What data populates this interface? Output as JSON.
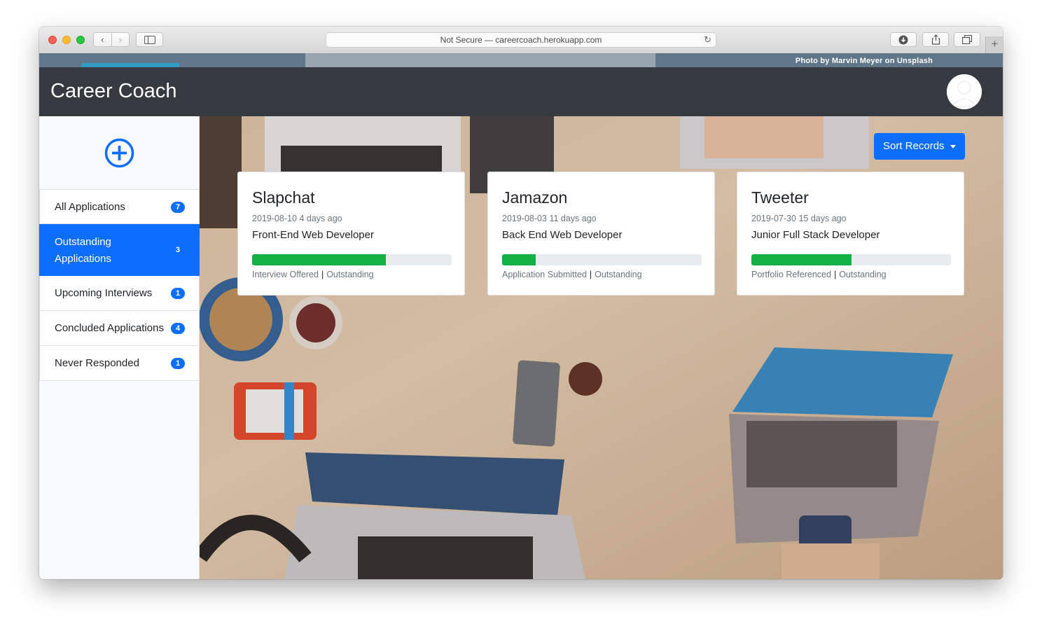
{
  "browser": {
    "url_text": "Not Secure — careercoach.herokuapp.com"
  },
  "page": {
    "photo_credit": "Photo by Marvin Meyer on Unsplash",
    "brand": "Career Coach"
  },
  "sidebar": {
    "items": [
      {
        "label": "All Applications",
        "count": "7",
        "active": false
      },
      {
        "label": "Outstanding Applications",
        "count": "3",
        "active": true
      },
      {
        "label": "Upcoming Interviews",
        "count": "1",
        "active": false
      },
      {
        "label": "Concluded Applications",
        "count": "4",
        "active": false
      },
      {
        "label": "Never Responded",
        "count": "1",
        "active": false
      }
    ]
  },
  "sort_button": {
    "label": "Sort Records"
  },
  "cards": [
    {
      "company": "Slapchat",
      "date": "2019-08-10",
      "ago": "4 days ago",
      "role": "Front-End Web Developer",
      "progress": 0.67,
      "stage": "Interview Offered",
      "state": "Outstanding"
    },
    {
      "company": "Jamazon",
      "date": "2019-08-03",
      "ago": "11 days ago",
      "role": "Back End Web Developer",
      "progress": 0.17,
      "stage": "Application Submitted",
      "state": "Outstanding"
    },
    {
      "company": "Tweeter",
      "date": "2019-07-30",
      "ago": "15 days ago",
      "role": "Junior Full Stack Developer",
      "progress": 0.5,
      "stage": "Portfolio Referenced",
      "state": "Outstanding"
    }
  ],
  "colors": {
    "primary": "#0d6efd",
    "navbar": "#343a40",
    "progress_fill": "#13b144"
  }
}
